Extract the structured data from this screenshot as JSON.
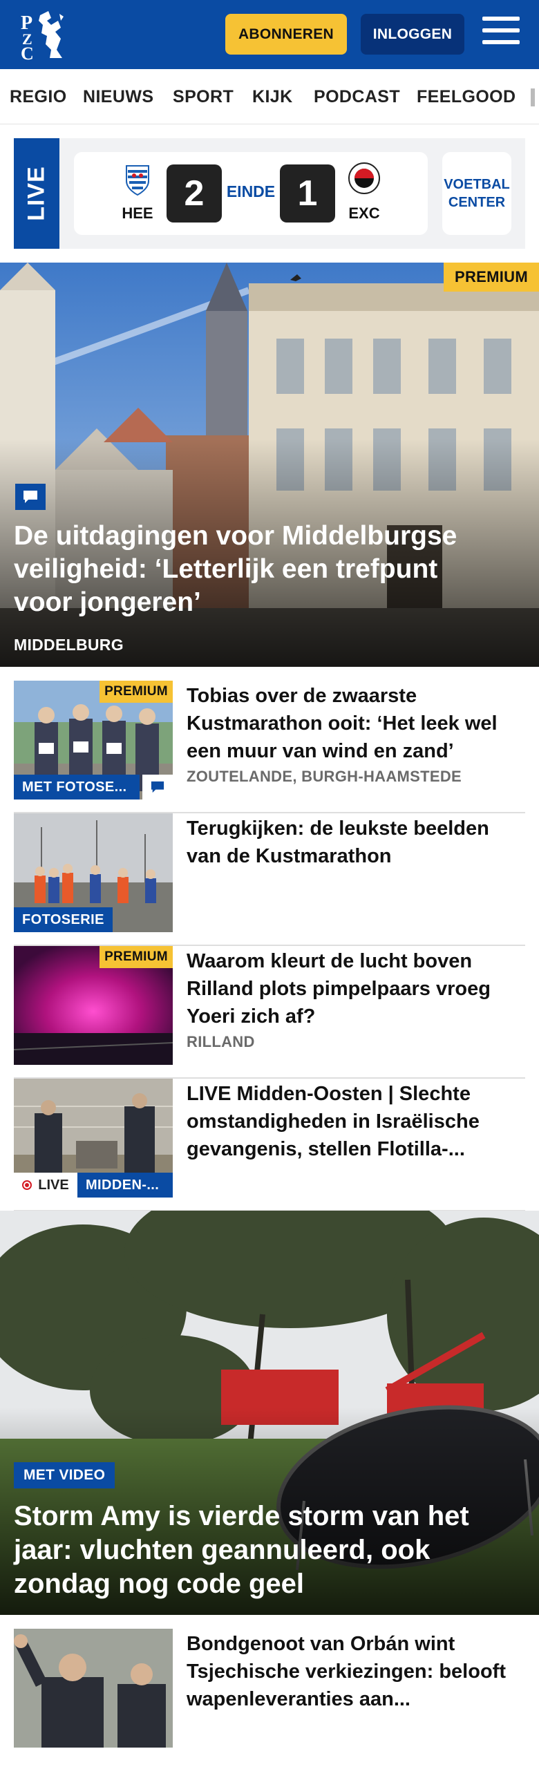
{
  "header": {
    "brand": "PZC",
    "subscribe_label": "ABONNEREN",
    "login_label": "INLOGGEN",
    "menu_icon": "hamburger-menu-icon",
    "colors": {
      "brand_blue": "#0a4ba3",
      "dark_blue": "#073279",
      "accent_yellow": "#f6c234"
    }
  },
  "nav": {
    "items": [
      "REGIO",
      "NIEUWS",
      "SPORT",
      "KIJK",
      "PODCAST",
      "FEELGOOD"
    ]
  },
  "live_score": {
    "label": "LIVE",
    "home_team": "HEE",
    "home_score": "2",
    "status": "EINDE",
    "away_score": "1",
    "away_team": "EXC",
    "center_button": "VOETBAL CENTER"
  },
  "hero": {
    "badge": "PREMIUM",
    "title": "De uitdagingen voor Middelburgse veiligheid: ‘Letterlijk een trefpunt voor jongeren’",
    "location": "MIDDELBURG"
  },
  "articles": [
    {
      "badge": "PREMIUM",
      "label": "MET FOTOSE...",
      "title": "Tobias over de zwaarste Kustmarathon ooit: ‘Het leek wel een muur van wind en zand’",
      "location": "ZOUTELANDE, BURGH-HAAMSTEDE"
    },
    {
      "label": "FOTOSERIE",
      "title": "Terugkijken: de leukste beelden van de Kustmarathon"
    },
    {
      "badge": "PREMIUM",
      "title": "Waarom kleurt de lucht boven Rilland plots pimpelpaars vroeg Yoeri zich af?",
      "location": "RILLAND"
    },
    {
      "live_label": "LIVE",
      "label": "MIDDEN-...",
      "title": "LIVE Midden-Oosten | Slechte omstandigheden in Israëlische gevangenis, stellen Flotilla-..."
    }
  ],
  "hero2": {
    "badge": "MET VIDEO",
    "title": "Storm Amy is vierde storm van het jaar: vluchten geannuleerd, ook zondag nog code geel"
  },
  "article_last": {
    "title": "Bondgenoot van Orbán wint Tsjechische verkiezingen: belooft wapenleveranties aan..."
  }
}
